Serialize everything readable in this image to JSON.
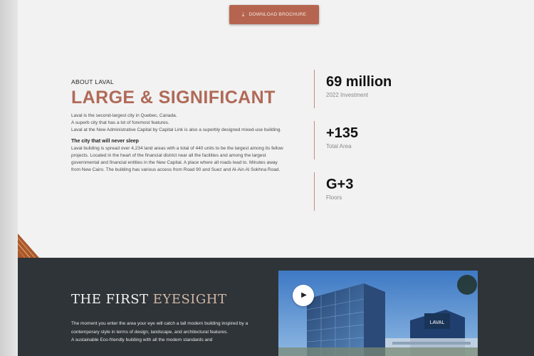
{
  "header": {
    "download_label": "DOWNLOAD BROCHURE",
    "download_icon": "download-icon"
  },
  "about": {
    "eyebrow": "ABOUT LAVAL",
    "headline": "LARGE & SIGNIFICANT",
    "intro": [
      "Laval is the second-largest city in Quebec, Canada.",
      "A superb city that has a lot of foremost features.",
      "Laval at the New Administrative Capital by Capital Link is also a superbly designed mixed-use building."
    ],
    "subhead": "The city that will never sleep",
    "body": "Laval building is spread over 4,234 land areas with a total of 440 units to be the largest among its fellow projects. Located in the heart of the financial district near all the facilities and among the largest governmental and financial entities in the New Capital. A place where all roads lead to. Minutes away from New Cairo. The building has various access from Road 90 and Suez and Al-Ain Al Sokhna Road."
  },
  "stats": [
    {
      "value": "69 million",
      "label": "2022 Investment"
    },
    {
      "value": "+135",
      "label": "Total Area"
    },
    {
      "value": "G+3",
      "label": "Floors"
    }
  ],
  "first_eyesight": {
    "title_main": "THE FIRST",
    "title_accent": "EYESIGHT",
    "paragraphs": [
      "The moment you enter the area your eye will catch a tall modern building inspired by a contemporary style in terms of design, landscape, and architectural features.",
      "A sustainable Eco-friendly building with all the modern standards and"
    ],
    "play_icon": "play-icon",
    "building_sign": "LAVAL"
  },
  "colors": {
    "accent": "#b06a57",
    "button": "#b5654f",
    "dark_section": "#2f3438",
    "divider": "#c58b7c"
  }
}
